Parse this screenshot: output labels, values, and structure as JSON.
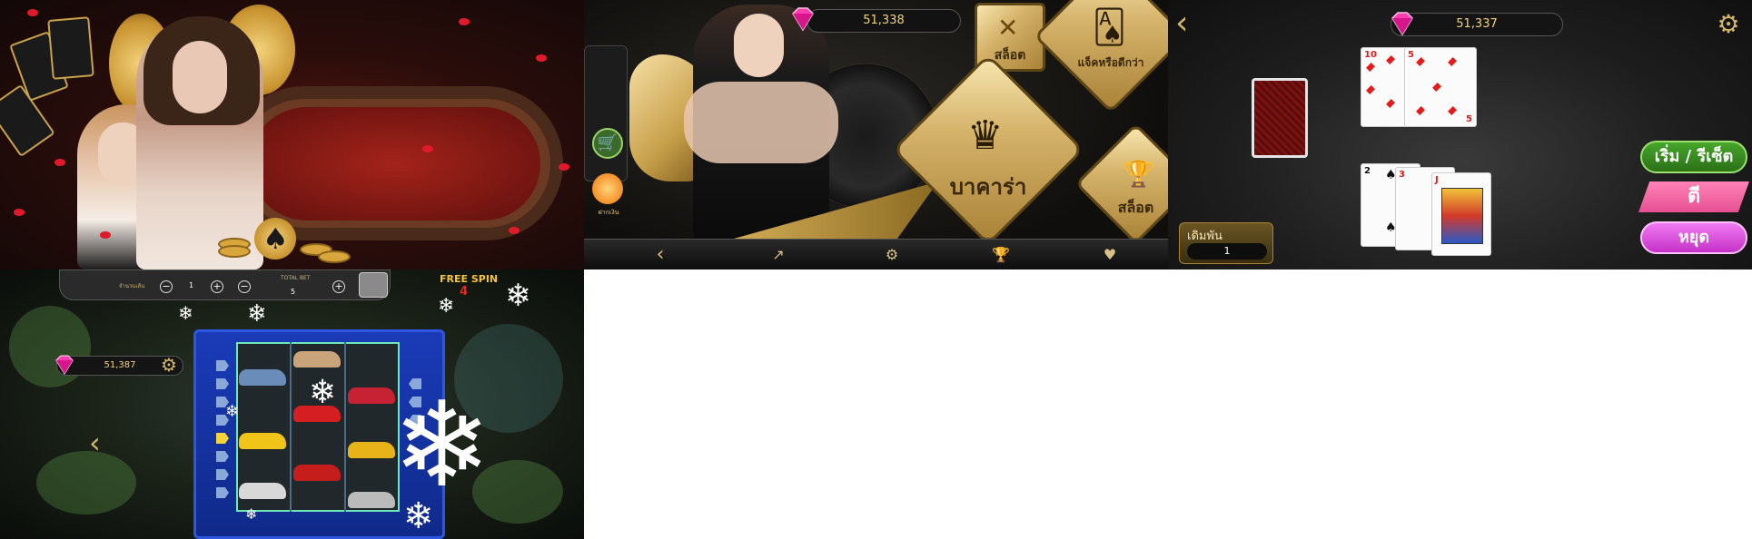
{
  "panel1": {},
  "panel2": {
    "balance": "51,338",
    "shop_label": "ฝากเงิน",
    "tiles": {
      "slot_top": "สล็อต",
      "blackjack": "แจ็คหรือดีกว่า",
      "baccarat": "บาคาร่า",
      "slot": "สล็อต"
    },
    "bottom_nav": {
      "back_icon": "chevron-left-icon",
      "share_icon": "share-icon",
      "settings_icon": "gear-icon",
      "trophy_icon": "trophy-icon",
      "heart_icon": "heart-hand-icon"
    }
  },
  "panel3": {
    "balance": "51,337",
    "dealer_card_rank": "10",
    "dealer_card_rank2": "5",
    "dealer_card_rank_bottom": "5",
    "player_card1_rank": "2",
    "player_card2_rank": "3",
    "player_card3_rank": "J",
    "bet_label": "เดิมพัน",
    "bet_value": "1",
    "buttons": {
      "deal": "เริ่ม / รีเซ็ต",
      "hit": "ตี",
      "stand": "หยุด"
    },
    "colors": {
      "deal": "#46a62a",
      "hit": "#ff83b6",
      "stand": "#f07af2"
    }
  },
  "panel4": {
    "lines_label": "จำนวนเส้น",
    "lines_value": "1",
    "total_bet_label": "TOTAL BET",
    "total_bet_value": "5",
    "free_spin_label": "FREE SPIN",
    "free_spin_count": "4",
    "balance": "51,387"
  }
}
